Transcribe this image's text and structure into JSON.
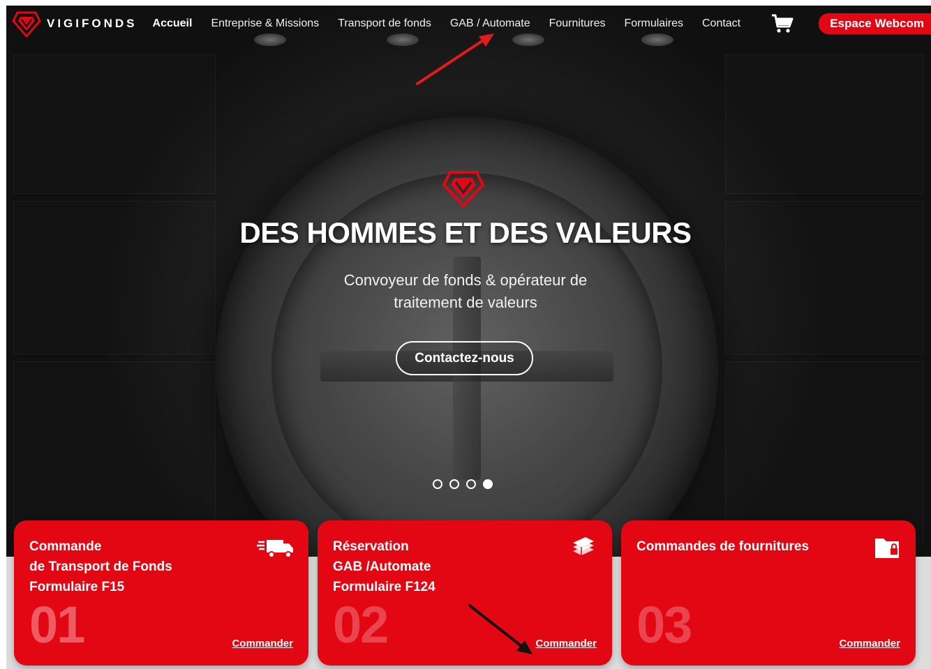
{
  "nav": {
    "brand": "VIGIFONDS",
    "links": [
      {
        "label": "Accueil",
        "active": true
      },
      {
        "label": "Entreprise & Missions",
        "active": false
      },
      {
        "label": "Transport de fonds",
        "active": false
      },
      {
        "label": "GAB / Automate",
        "active": false
      },
      {
        "label": "Fournitures",
        "active": false
      },
      {
        "label": "Formulaires",
        "active": false
      },
      {
        "label": "Contact",
        "active": false
      }
    ],
    "cart_icon": "cart-icon",
    "webcom_label": "Espace Webcom"
  },
  "hero": {
    "title": "DES HOMMES ET DES VALEURS",
    "subtitle": "Convoyeur de fonds & opérateur de traitement de valeurs",
    "cta_label": "Contactez-nous",
    "slides": 4,
    "active_slide": 4
  },
  "cards": [
    {
      "title_lines": [
        "Commande",
        "de Transport de Fonds",
        "Formulaire F15"
      ],
      "number": "01",
      "link": "Commander",
      "icon": "delivery-truck-icon"
    },
    {
      "title_lines": [
        "Réservation",
        "GAB /Automate",
        "Formulaire F124"
      ],
      "number": "02",
      "link": "Commander",
      "icon": "cash-stack-icon"
    },
    {
      "title_lines": [
        "Commandes de fournitures"
      ],
      "number": "03",
      "link": "Commander",
      "icon": "locked-folder-icon"
    }
  ],
  "colors": {
    "brand_red": "#e30613",
    "annotation_red": "#e31b1b",
    "annotation_black": "#111111"
  }
}
